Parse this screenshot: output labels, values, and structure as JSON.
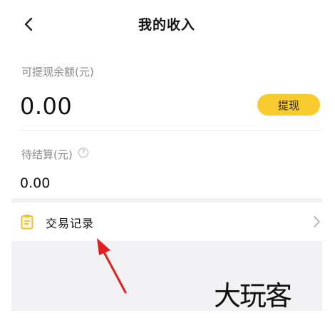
{
  "header": {
    "title": "我的收入",
    "back_icon": "chevron-left-icon"
  },
  "balance": {
    "withdrawable_label": "可提现余额(元)",
    "withdrawable_value": "0.00",
    "withdraw_button_label": "提现",
    "pending_label": "待结算(元)",
    "pending_value": "0.00",
    "help_glyph": "?"
  },
  "records": {
    "label": "交易记录",
    "icon": "clipboard-icon",
    "chevron_icon": "chevron-right-icon"
  },
  "annotation": {
    "watermark": "大玩客",
    "arrow_color": "#e02020"
  },
  "colors": {
    "accent": "#f8cb2e",
    "icon_yellow": "#f2c12e",
    "page_bg": "#f2f2f4"
  }
}
